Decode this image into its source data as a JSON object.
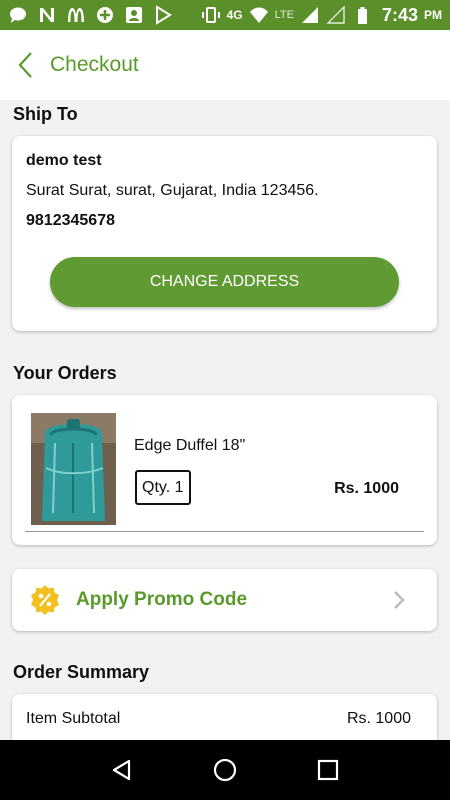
{
  "status_bar": {
    "network_label": "4G",
    "lte_label": "LTE",
    "time": "7:43",
    "ampm": "PM",
    "icons": [
      "message-icon",
      "n-icon",
      "mcdonalds-icon",
      "plus-circle-icon",
      "contact-icon",
      "play-store-icon",
      "vibrate-icon",
      "wifi-icon",
      "signal-icon",
      "battery-icon"
    ],
    "color": "#5a8f2a"
  },
  "app_bar": {
    "title": "Checkout",
    "accent_color": "#5a9a2a"
  },
  "ship_to": {
    "section_title": "Ship To",
    "name": "demo test",
    "address": "Surat Surat, surat, Gujarat, India 123456.",
    "phone": "9812345678",
    "change_button_label": "CHANGE ADDRESS",
    "button_color": "#5f9a33"
  },
  "orders": {
    "section_title": "Your Orders",
    "items": [
      {
        "name": "Edge Duffel 18\"",
        "qty_label": "Qty. 1",
        "price": "Rs. 1000"
      }
    ]
  },
  "promo": {
    "label": "Apply Promo Code",
    "icon": "percent-badge-icon",
    "icon_color": "#f2c01e"
  },
  "summary": {
    "section_title": "Order Summary",
    "rows": [
      {
        "label": "Item Subtotal",
        "value": "Rs. 1000"
      }
    ]
  }
}
